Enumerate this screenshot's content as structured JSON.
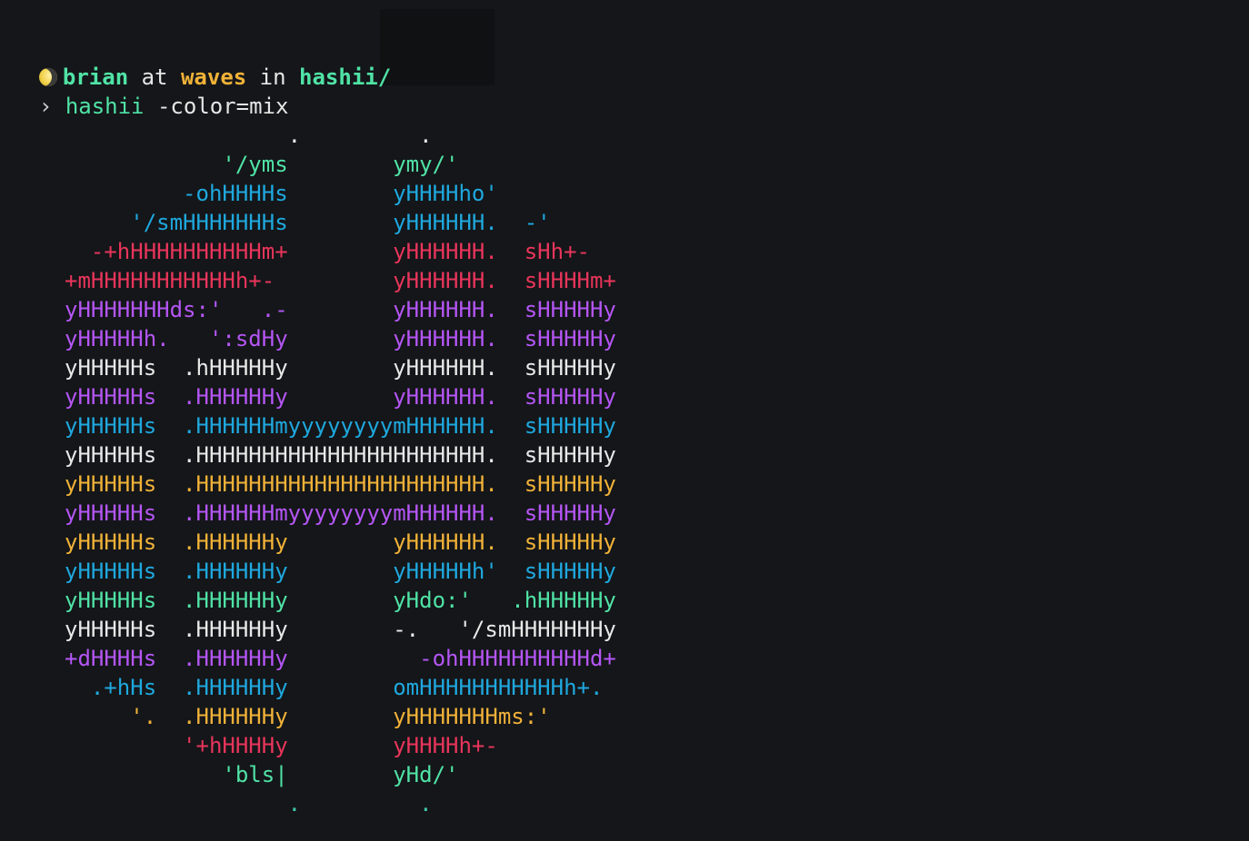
{
  "prompt": {
    "user": "brian",
    "at": "at",
    "host": "waves",
    "in": "in",
    "dir": "hashii/",
    "arrow": "›",
    "command": "hashii",
    "args": " -color=mix",
    "colors": {
      "user": "#50e3a6",
      "host": "#f1b238",
      "dir": "#50e3a6",
      "command": "#50e3a6"
    }
  },
  "ascii_art": {
    "rows": [
      {
        "text": "                 .         .",
        "color": "c-white"
      },
      {
        "text": "            '/yms        ymy/'",
        "color": "c-green"
      },
      {
        "text": "         -ohHHHHs        yHHHHho'",
        "color": "c-cyan"
      },
      {
        "text": "     '/smHHHHHHHs        yHHHHHH.  -'",
        "color": "c-cyan"
      },
      {
        "text": "  -+hHHHHHHHHHHm+        yHHHHHH.  sHh+-",
        "color": "c-red"
      },
      {
        "text": "+mHHHHHHHHHHHh+-         yHHHHHH.  sHHHHm+",
        "color": "c-red"
      },
      {
        "text": "yHHHHHHHds:'   .-        yHHHHHH.  sHHHHHy",
        "color": "c-purple"
      },
      {
        "text": "yHHHHHh.   ':sdHy        yHHHHHH.  sHHHHHy",
        "color": "c-purple"
      },
      {
        "text": "yHHHHHs  .hHHHHHy        yHHHHHH.  sHHHHHy",
        "color": "c-white"
      },
      {
        "text": "yHHHHHs  .HHHHHHy        yHHHHHH.  sHHHHHy",
        "color": "c-purple"
      },
      {
        "text": "yHHHHHs  .HHHHHHmyyyyyyyymHHHHHH.  sHHHHHy",
        "color": "c-cyan"
      },
      {
        "text": "yHHHHHs  .HHHHHHHHHHHHHHHHHHHHHH.  sHHHHHy",
        "color": "c-white"
      },
      {
        "text": "yHHHHHs  .HHHHHHHHHHHHHHHHHHHHHH.  sHHHHHy",
        "color": "c-yellow"
      },
      {
        "text": "yHHHHHs  .HHHHHHmyyyyyyyymHHHHHH.  sHHHHHy",
        "color": "c-purple"
      },
      {
        "text": "yHHHHHs  .HHHHHHy        yHHHHHH.  sHHHHHy",
        "color": "c-yellow"
      },
      {
        "text": "yHHHHHs  .HHHHHHy        yHHHHHh'  sHHHHHy",
        "color": "c-cyan"
      },
      {
        "text": "yHHHHHs  .HHHHHHy        yHdo:'   .hHHHHHy",
        "color": "c-green"
      },
      {
        "text": "yHHHHHs  .HHHHHHy        -.   '/smHHHHHHHy",
        "color": "c-white"
      },
      {
        "text": "+dHHHHs  .HHHHHHy          -ohHHHHHHHHHHd+",
        "color": "c-purple"
      },
      {
        "text": "  .+hHs  .HHHHHHy        omHHHHHHHHHHHh+.",
        "color": "c-cyan"
      },
      {
        "text": "     '.  .HHHHHHy        yHHHHHHHms:'",
        "color": "c-yellow"
      },
      {
        "text": "         '+hHHHHy        yHHHHh+-",
        "color": "c-red"
      },
      {
        "text": "            'bls|        yHd/'",
        "color": "c-green"
      },
      {
        "text": "                 .         .",
        "color": "c-teal"
      }
    ]
  }
}
